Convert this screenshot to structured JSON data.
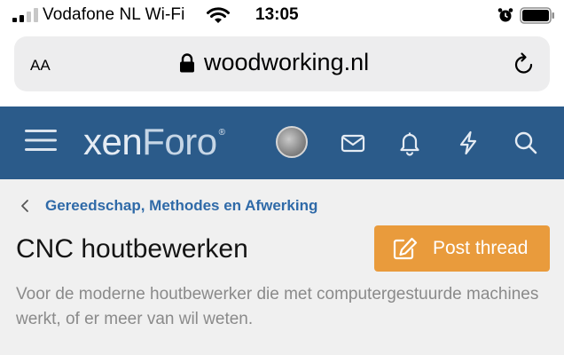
{
  "status_bar": {
    "carrier": "Vodafone NL Wi-Fi",
    "time": "13:05",
    "icons": [
      "signal-icon",
      "wifi-icon",
      "alarm-icon",
      "battery-icon"
    ]
  },
  "address_bar": {
    "text_size_label": "AA",
    "url": "woodworking.nl",
    "icons": [
      "lock-icon",
      "reload-icon"
    ]
  },
  "navbar": {
    "logo_part1": "xen",
    "logo_part2": "Foro",
    "logo_mark": "®",
    "background_color": "#2b5b8a",
    "icons": [
      "hamburger-icon",
      "avatar",
      "mail-icon",
      "bell-icon",
      "bolt-icon",
      "search-icon"
    ]
  },
  "breadcrumb": {
    "parent": "Gereedschap, Methodes en Afwerking"
  },
  "page": {
    "title": "CNC houtbewerken",
    "post_button_label": "Post thread",
    "description": "Voor de moderne houtbewerker die met computergestuurde machines werkt, of er meer van wil weten.",
    "accent_color": "#e99b3c",
    "link_color": "#2f6aa8"
  }
}
